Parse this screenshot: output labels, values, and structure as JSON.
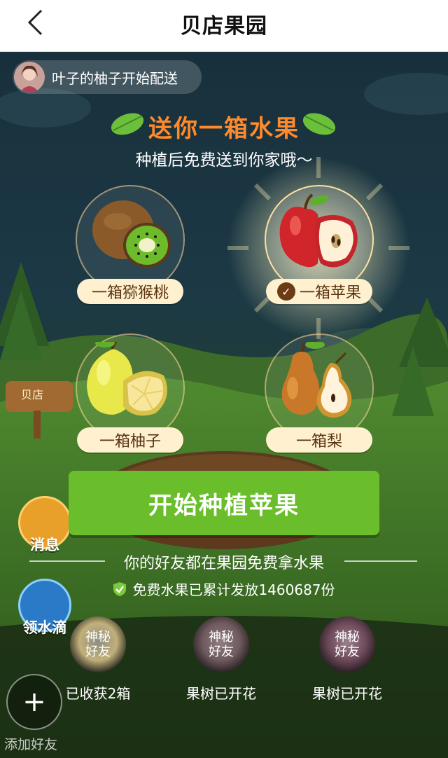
{
  "nav": {
    "title": "贝店果园",
    "back_icon": "chevron-left-icon"
  },
  "notice": {
    "text": "叶子的柚子开始配送"
  },
  "hero": {
    "title": "送你一箱水果",
    "subtitle": "种植后免费送到你家哦～"
  },
  "fruits": [
    {
      "label": "一箱猕猴桃",
      "icon": "kiwi-icon",
      "selected": false
    },
    {
      "label": "一箱苹果",
      "icon": "apple-icon",
      "selected": true
    },
    {
      "label": "一箱柚子",
      "icon": "pomelo-icon",
      "selected": false
    },
    {
      "label": "一箱梨",
      "icon": "pear-icon",
      "selected": false
    }
  ],
  "cta": {
    "label": "开始种植苹果",
    "color": "#6abe2b"
  },
  "friends": {
    "title": "你的好友都在果园免费拿水果",
    "stat": "免费水果已累计发放1460687份",
    "list": [
      {
        "name": "神秘好友",
        "name_line1": "神秘",
        "name_line2": "好友",
        "status": "已收获2箱"
      },
      {
        "name": "神秘好友",
        "name_line1": "神秘",
        "name_line2": "好友",
        "status": "果树已开花"
      },
      {
        "name": "神秘好友",
        "name_line1": "神秘",
        "name_line2": "好友",
        "status": "果树已开花"
      }
    ]
  },
  "side": {
    "messages": "消息",
    "water": "领水滴",
    "sign": "贝店"
  },
  "add_friend": {
    "label": "添加好友"
  },
  "colors": {
    "accent_orange": "#ff8a2c",
    "label_bg": "#fff1cf",
    "label_text": "#5a3310"
  }
}
